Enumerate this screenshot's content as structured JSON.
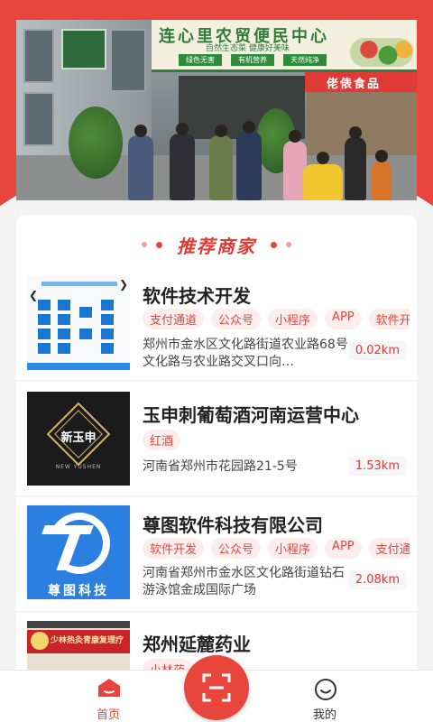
{
  "banner": {
    "sign_title": "连心里农贸便民中心",
    "sign_subtitle": "自然生态菜  健康好美味",
    "sign_tags": [
      "绿色无害",
      "有机营养",
      "天然纯净"
    ],
    "shop_sign": "佬俵食品"
  },
  "section": {
    "title": "推荐商家"
  },
  "merchants": [
    {
      "name": "软件技术开发",
      "tags": [
        "支付通道",
        "公众号",
        "小程序",
        "APP",
        "软件开发"
      ],
      "address": "郑州市金水区文化路街道农业路68号文化路与农业路交叉口向…",
      "distance": "0.02km"
    },
    {
      "name": "玉申刺葡萄酒河南运营中心",
      "tags": [
        "红酒"
      ],
      "address": "河南省郑州市花园路21-5号",
      "distance": "1.53km",
      "logo_text": "新玉申",
      "logo_sub": "NEW YUSHEN"
    },
    {
      "name": "尊图软件科技有限公司",
      "tags": [
        "软件开发",
        "公众号",
        "小程序",
        "APP",
        "支付通道"
      ],
      "address": "河南省郑州市金水区文化路街道钻石游泳馆金成国际广场",
      "distance": "2.08km",
      "logo_text": "尊图科技"
    },
    {
      "name": "郑州延麓药业",
      "tags": [
        "小林药"
      ],
      "address": "",
      "distance": "",
      "sign_text": "少林热灸青康复理疗"
    }
  ],
  "tabbar": {
    "home_label": "首页",
    "me_label": "我的",
    "accent_color": "#e8453c"
  }
}
